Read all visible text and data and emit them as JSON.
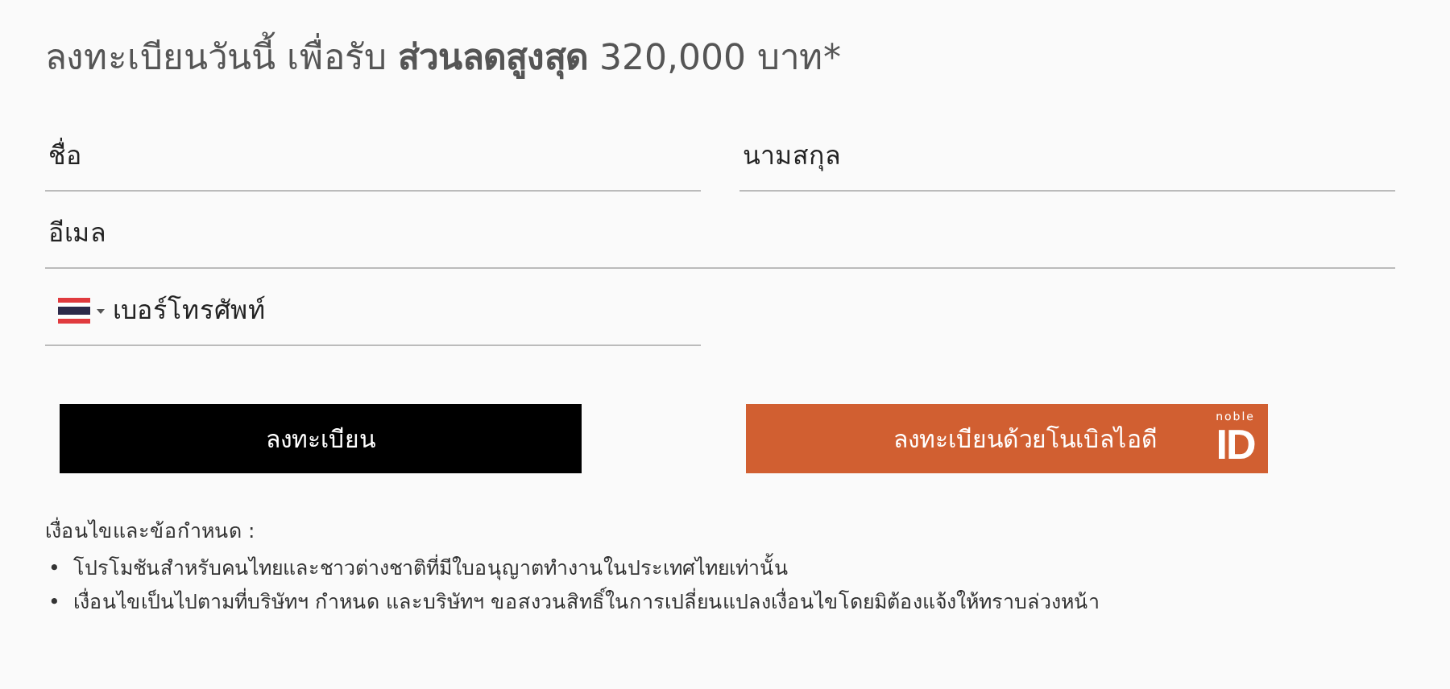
{
  "heading": "ลงทะเบียนวันนี้ เพื่อรับ **ส่วนลดสูงสุด** 320,000 บาท*",
  "fields": {
    "first_name": {
      "placeholder": "ชื่อ"
    },
    "last_name": {
      "placeholder": "นามสกุล"
    },
    "email": {
      "placeholder": "อีเมล"
    },
    "phone": {
      "placeholder": "เบอร์โทรศัพท์"
    }
  },
  "buttons": {
    "register": "ลงทะเบียน",
    "noble_id": {
      "label": "ลงทะเบียนด้วยโนเบิลไอดี",
      "logo_small": "noble",
      "logo_big": "ID"
    }
  },
  "terms": {
    "title": "เงื่อนไขและข้อกำหนด :",
    "items": [
      {
        "bullet": "•",
        "text": "โปรโมชันสำหรับคนไทยและชาวต่างชาติที่มีใบอนุญาตทำงานในประเทศไทยเท่านั้น"
      },
      {
        "bullet": "•",
        "text": "เงื่อนไขเป็นไปตามที่บริษัทฯ กำหนด และบริษัทฯ ขอสงวนสิทธิ์ในการเปลี่ยนแปลงเงื่อนไขโดยมิต้องแจ้งให้ทราบล่วงหน้า"
      }
    ]
  }
}
